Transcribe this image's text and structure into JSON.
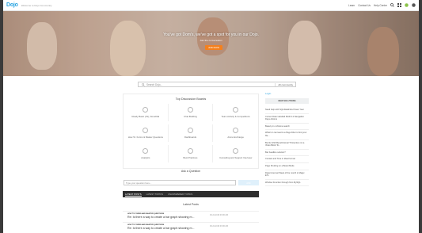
{
  "topbar": {
    "logo": "Dojo",
    "tagline": "Welcome to Dojo Community",
    "links": [
      "Learn",
      "Contact Us",
      "Help Center"
    ]
  },
  "hero": {
    "headline": "You've got Dom's, we've got a spot for you in our Dojo.",
    "sub": "Join the conversation",
    "button": "JOIN NOW"
  },
  "search": {
    "placeholder": "Search Dojo...",
    "scope": "All community"
  },
  "boards": {
    "title": "Top Discussion Boards",
    "items": [
      {
        "label": "Ready Basic (JS), DoneDial"
      },
      {
        "label": "Chat Building"
      },
      {
        "label": "Team Activity & Competitions"
      },
      {
        "label": "How To: Forms & Master Questions"
      },
      {
        "label": "Dashboards"
      },
      {
        "label": "Azure Exchange"
      },
      {
        "label": "Analytics"
      },
      {
        "label": "Best Practices"
      },
      {
        "label": "Consulting and Support Interview"
      }
    ]
  },
  "ask": {
    "title": "Ask a Question",
    "placeholder": "Type your question here...",
    "button": "ASK"
  },
  "tabs": [
    "LATEST POSTS",
    "LATEST TOPICS",
    "UNANSWERED TOPICS"
  ],
  "latest": {
    "title": "Latest Posts",
    "posts": [
      {
        "cat": "HOW TO FORMS AND MASTER QUESTIONS",
        "title": "Re: Is there a way to create a bar graph showing m...",
        "date": "06-22-2018 03:06 AM"
      },
      {
        "cat": "HOW TO FORMS AND MASTER QUESTIONS",
        "title": "Re: Is there a way to create a bar graph showing m...",
        "date": "06-22-2018 03:06 AM"
      }
    ]
  },
  "sidebar": {
    "login": "Login",
    "new_solutions": "NEW SOLUTIONS",
    "items": [
      "Need help with SQL/DataFlow Power Year",
      "Current Date Handled MAD 3.2 Navigation Days Actions",
      "Beauty in a Volume search",
      "What's it can lead to a Page Filter to find your file...",
      "Burrito Shift Benefit Email \"Protection not a Video Block To...",
      "Bar headline solution?",
      "Contact and Time in Idea Format",
      "Page Shutting on a Beast Mode",
      "Determine last Week of the month in Magic ETL",
      "Window Function through from MySQL"
    ]
  }
}
